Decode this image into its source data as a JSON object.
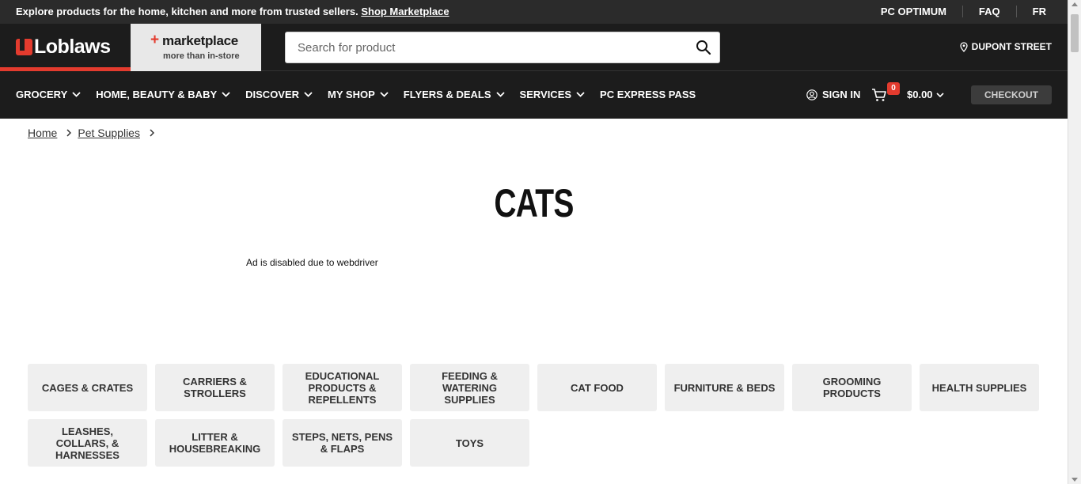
{
  "promo": {
    "text": "Explore products for the home, kitchen and more from trusted sellers.",
    "link": "Shop Marketplace",
    "right_links": [
      "PC OPTIMUM",
      "FAQ",
      "FR"
    ]
  },
  "header": {
    "logo": "Loblaws",
    "marketplace_title": "marketplace",
    "marketplace_sub": "more than in-store",
    "search_placeholder": "Search for product",
    "store": "DUPONT STREET"
  },
  "nav": {
    "items": [
      {
        "label": "GROCERY",
        "dropdown": true
      },
      {
        "label": "HOME, BEAUTY & BABY",
        "dropdown": true
      },
      {
        "label": "DISCOVER",
        "dropdown": true
      },
      {
        "label": "MY SHOP",
        "dropdown": true
      },
      {
        "label": "FLYERS & DEALS",
        "dropdown": true
      },
      {
        "label": "SERVICES",
        "dropdown": true
      },
      {
        "label": "PC EXPRESS PASS",
        "dropdown": false
      }
    ],
    "sign_in": "SIGN IN",
    "cart_count": "0",
    "cart_total": "$0.00",
    "checkout": "CHECKOUT"
  },
  "breadcrumb": [
    "Home",
    "Pet Supplies"
  ],
  "page_title": "CATS",
  "ad_note": "Ad is disabled due to webdriver",
  "categories": [
    "CAGES & CRATES",
    "CARRIERS & STROLLERS",
    "EDUCATIONAL PRODUCTS & REPELLENTS",
    "FEEDING & WATERING SUPPLIES",
    "CAT FOOD",
    "FURNITURE & BEDS",
    "GROOMING PRODUCTS",
    "HEALTH SUPPLIES",
    "LEASHES, COLLARS, & HARNESSES",
    "LITTER & HOUSEBREAKING",
    "STEPS, NETS, PENS & FLAPS",
    "TOYS"
  ],
  "colors": {
    "brand_red": "#e33b2e",
    "header_bg": "#1c1c1c",
    "promo_bg": "#2b2b2b",
    "tile_bg": "#efefef"
  }
}
